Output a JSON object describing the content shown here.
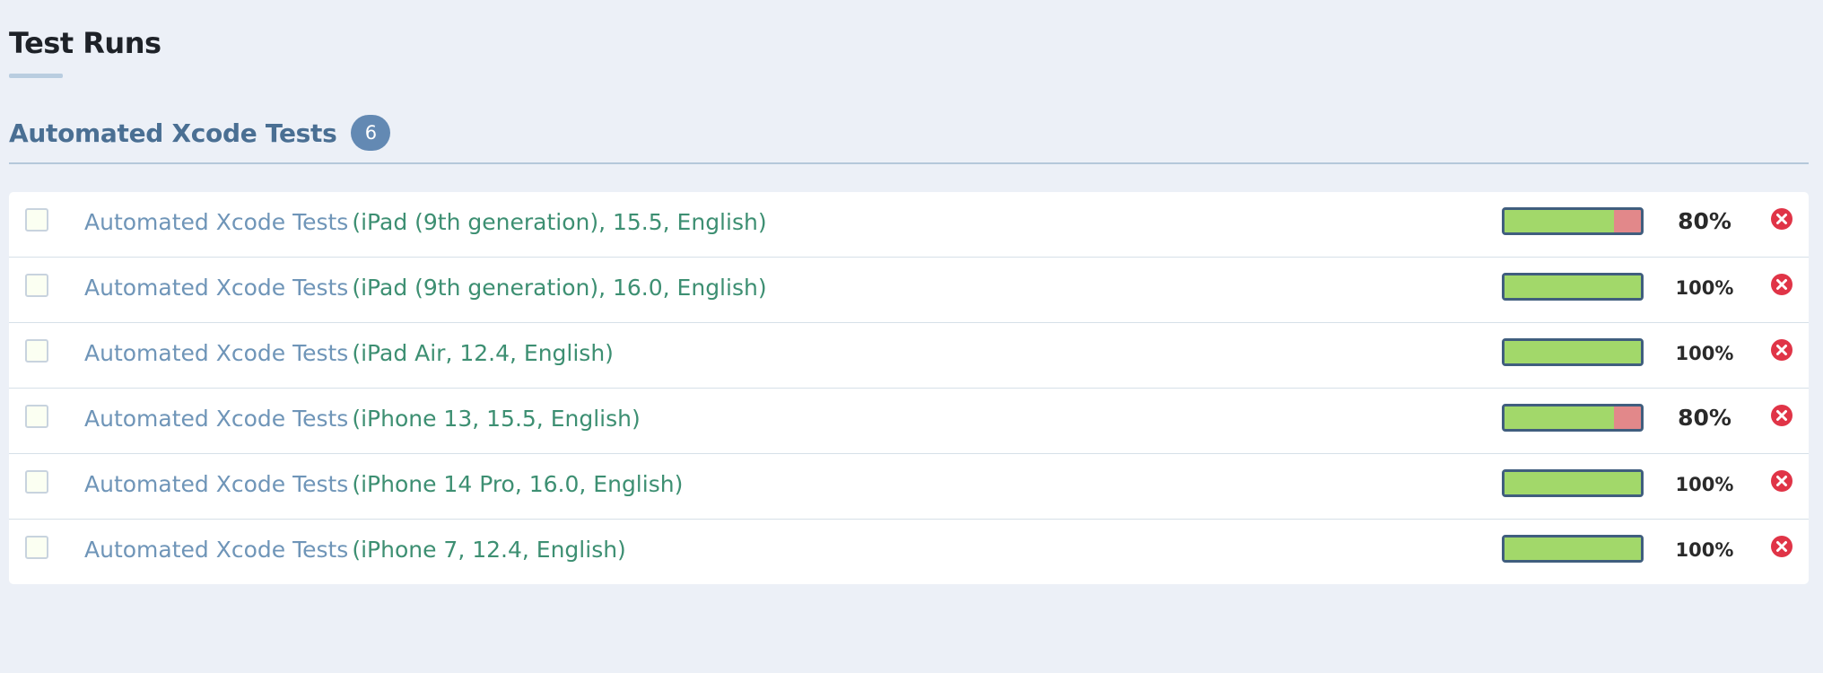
{
  "page": {
    "title": "Test Runs"
  },
  "section": {
    "title": "Automated Xcode Tests",
    "count": "6"
  },
  "colors": {
    "pass": "#a2d86a",
    "fail": "#e2888a",
    "delete": "#e03447",
    "link": "#6f95b8",
    "config": "#3d8f72"
  },
  "runs": [
    {
      "name": "Automated Xcode Tests",
      "config": "(iPad (9th generation), 15.5, English)",
      "pass_fraction": 0.8,
      "percent": "80%"
    },
    {
      "name": "Automated Xcode Tests",
      "config": "(iPad (9th generation), 16.0, English)",
      "pass_fraction": 1.0,
      "percent": "100%"
    },
    {
      "name": "Automated Xcode Tests",
      "config": "(iPad Air, 12.4, English)",
      "pass_fraction": 1.0,
      "percent": "100%"
    },
    {
      "name": "Automated Xcode Tests",
      "config": "(iPhone 13, 15.5, English)",
      "pass_fraction": 0.8,
      "percent": "80%"
    },
    {
      "name": "Automated Xcode Tests",
      "config": "(iPhone 14 Pro, 16.0, English)",
      "pass_fraction": 1.0,
      "percent": "100%"
    },
    {
      "name": "Automated Xcode Tests",
      "config": "(iPhone 7, 12.4, English)",
      "pass_fraction": 1.0,
      "percent": "100%"
    }
  ],
  "icons": {
    "delete": "close-circle-icon"
  }
}
